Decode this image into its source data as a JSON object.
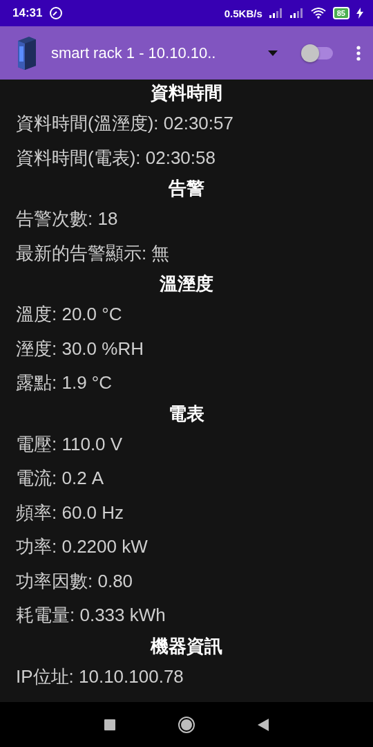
{
  "status_bar": {
    "time": "14:31",
    "net_speed": "0.5KB/s",
    "battery": "85"
  },
  "app_bar": {
    "title": "smart rack 1 - 10.10.10..",
    "switch": {
      "on": false
    }
  },
  "sections": [
    {
      "heading": "資料時間",
      "rows": [
        "資料時間(溫溼度): 02:30:57",
        "資料時間(電表): 02:30:58"
      ]
    },
    {
      "heading": "告警",
      "rows": [
        "告警次數: 18",
        "最新的告警顯示: 無"
      ]
    },
    {
      "heading": "溫溼度",
      "rows": [
        "溫度: 20.0 °C",
        "溼度: 30.0 %RH",
        "露點: 1.9 °C"
      ]
    },
    {
      "heading": "電表",
      "rows": [
        "電壓: 110.0 V",
        "電流: 0.2 A",
        "頻率: 60.0 Hz",
        "功率: 0.2200 kW",
        "功率因數: 0.80",
        "耗電量: 0.333 kWh"
      ]
    },
    {
      "heading": "機器資訊",
      "rows": [
        "IP位址: 10.10.100.78"
      ]
    }
  ]
}
